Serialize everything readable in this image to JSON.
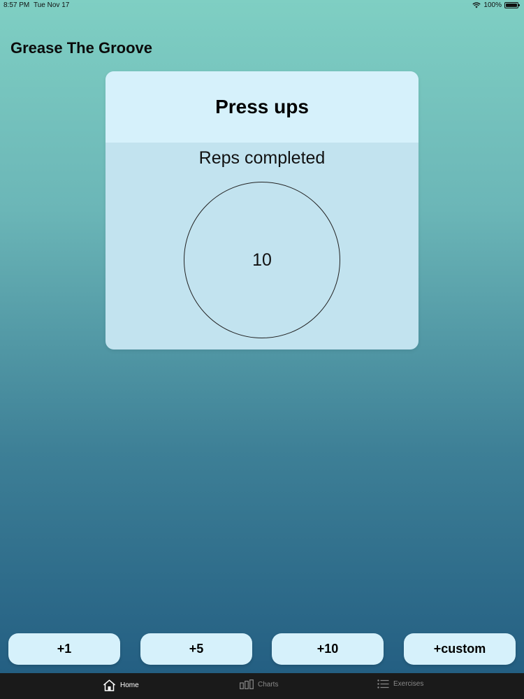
{
  "status_bar": {
    "time": "8:57 PM",
    "date": "Tue Nov 17",
    "battery_text": "100%",
    "battery_level": 1.0
  },
  "app": {
    "title": "Grease The Groove"
  },
  "exercise_card": {
    "title": "Press ups",
    "reps_label": "Reps completed",
    "reps_value": "10"
  },
  "buttons": [
    {
      "label": "+1"
    },
    {
      "label": "+5"
    },
    {
      "label": "+10"
    },
    {
      "label": "+custom"
    }
  ],
  "tabs": [
    {
      "label": "Home",
      "icon": "house-icon",
      "active": true
    },
    {
      "label": "Charts",
      "icon": "bar-chart-icon",
      "active": false
    },
    {
      "label": "Exercises",
      "icon": "list-icon",
      "active": false
    }
  ],
  "colors": {
    "card_header": "#d6f1fb",
    "card_body": "#c2e3ef",
    "button_bg": "#d6f1fb",
    "tab_bar_bg": "#1a1a1a",
    "gradient_top": "#7fcfc3",
    "gradient_bottom": "#215b80"
  }
}
